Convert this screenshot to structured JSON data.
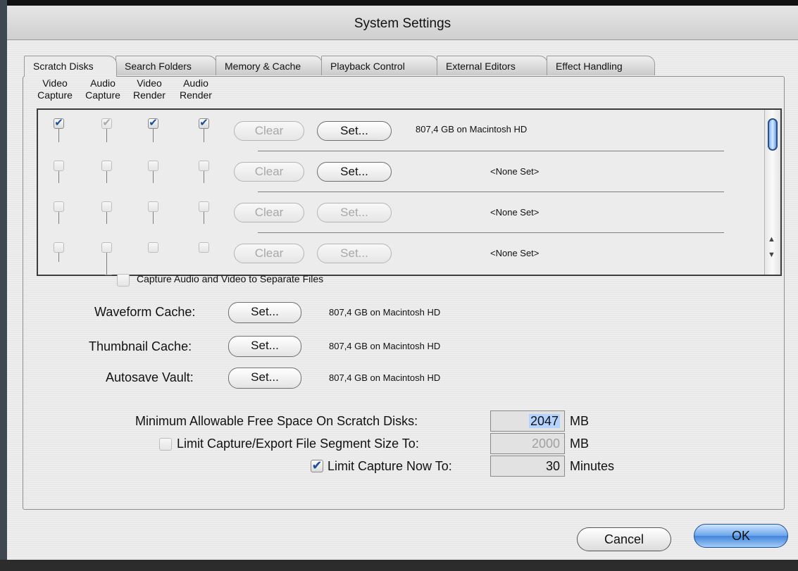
{
  "window": {
    "title": "System Settings"
  },
  "tabs": [
    {
      "label": "Scratch Disks",
      "active": true
    },
    {
      "label": "Search Folders",
      "active": false
    },
    {
      "label": "Memory & Cache",
      "active": false
    },
    {
      "label": "Playback Control",
      "active": false
    },
    {
      "label": "External Editors",
      "active": false
    },
    {
      "label": "Effect Handling",
      "active": false
    }
  ],
  "columns": [
    {
      "line1": "Video",
      "line2": "Capture"
    },
    {
      "line1": "Audio",
      "line2": "Capture"
    },
    {
      "line1": "Video",
      "line2": "Render"
    },
    {
      "line1": "Audio",
      "line2": "Render"
    }
  ],
  "disk_rows": [
    {
      "checks": [
        true,
        true,
        true,
        true
      ],
      "dims": [
        false,
        true,
        false,
        false
      ],
      "clear": "Clear",
      "set": "Set...",
      "set_enabled": true,
      "location": "807,4 GB on  Macintosh HD"
    },
    {
      "checks": [
        false,
        false,
        false,
        false
      ],
      "dims": [
        true,
        true,
        true,
        true
      ],
      "clear": "Clear",
      "set": "Set...",
      "set_enabled": true,
      "location": "<None Set>"
    },
    {
      "checks": [
        false,
        false,
        false,
        false
      ],
      "dims": [
        true,
        true,
        true,
        true
      ],
      "clear": "Clear",
      "set": "Set...",
      "set_enabled": false,
      "location": "<None Set>"
    },
    {
      "checks": [
        false,
        false,
        false,
        false
      ],
      "dims": [
        true,
        true,
        true,
        true
      ],
      "clear": "Clear",
      "set": "Set...",
      "set_enabled": false,
      "location": "<None Set>"
    }
  ],
  "separate_files": {
    "label": "Capture Audio and Video to Separate Files",
    "checked": false
  },
  "caches": [
    {
      "label": "Waveform Cache:",
      "button": "Set...",
      "location": "807,4 GB on  Macintosh HD"
    },
    {
      "label": "Thumbnail Cache:",
      "button": "Set...",
      "location": "807,4 GB on  Macintosh HD"
    },
    {
      "label": "Autosave Vault:",
      "button": "Set...",
      "location": "807,4 GB on  Macintosh HD"
    }
  ],
  "limits": {
    "min_free": {
      "label": "Minimum Allowable Free Space On Scratch Disks:",
      "value": "2047",
      "unit": "MB"
    },
    "segment": {
      "label": "Limit Capture/Export File Segment Size To:",
      "checked": false,
      "value": "2000",
      "unit": "MB"
    },
    "capture_now": {
      "label": "Limit Capture Now To:",
      "checked": true,
      "value": "30",
      "unit": "Minutes"
    }
  },
  "buttons": {
    "cancel": "Cancel",
    "ok": "OK"
  },
  "icons": {
    "check": "✔",
    "scroll_up": "▲",
    "scroll_down": "▼"
  },
  "colors": {
    "accent": "#3f84db",
    "check": "#1a4e9c"
  }
}
